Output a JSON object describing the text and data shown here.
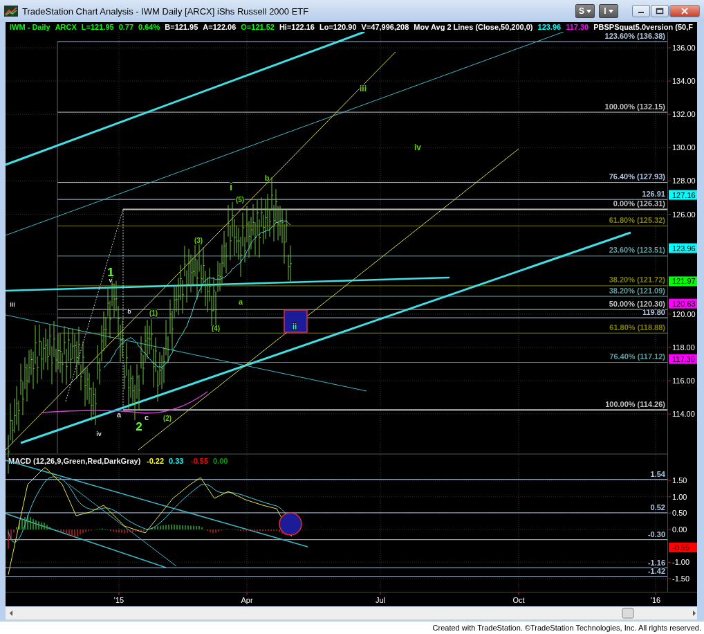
{
  "window": {
    "title": "TradeStation Chart Analysis - IWM Daily [ARCX] iShs Russell 2000 ETF",
    "menu_buttons": [
      "S",
      "I"
    ]
  },
  "header": [
    {
      "text": "IWM - Daily",
      "color": "#00ff00"
    },
    {
      "text": "ARCX",
      "color": "#00ff00"
    },
    {
      "text": "L=121.95",
      "color": "#00ff00"
    },
    {
      "text": "0.77",
      "color": "#00ff00"
    },
    {
      "text": "0.64%",
      "color": "#00ff00"
    },
    {
      "text": "B=121.95",
      "color": "#ffffff"
    },
    {
      "text": "A=122.06",
      "color": "#ffffff"
    },
    {
      "text": "O=121.52",
      "color": "#00ff00"
    },
    {
      "text": "Hi=122.16",
      "color": "#ffffff"
    },
    {
      "text": "Lo=120.90",
      "color": "#ffffff"
    },
    {
      "text": "V=47,996,208",
      "color": "#ffffff"
    },
    {
      "text": "Mov Avg 2 Lines (Close,50,200,0)",
      "color": "#ffffff"
    },
    {
      "text": "123.96",
      "color": "#00ffff"
    },
    {
      "text": "117.30",
      "color": "#ff00ff"
    },
    {
      "text": "PBSPSquat5.0version (50,F",
      "color": "#ffffff"
    }
  ],
  "price_axis": {
    "ticks": [
      "136.00",
      "134.00",
      "132.00",
      "130.00",
      "128.00",
      "126.00",
      "120.00",
      "118.00",
      "116.00",
      "114.00"
    ],
    "badges": [
      {
        "text": "127.16",
        "color": "#00ffff"
      },
      {
        "text": "123.96",
        "color": "#00ffff"
      },
      {
        "text": "121.97",
        "color": "#00ff00"
      },
      {
        "text": "120.63",
        "color": "#ff00ff"
      },
      {
        "text": "117.30",
        "color": "#ff00ff"
      }
    ]
  },
  "fib_levels": [
    {
      "text": "123.60% (136.38)",
      "color": "#b0c4de"
    },
    {
      "text": "100.00% (132.15)",
      "color": "#c0c0c0"
    },
    {
      "text": "76.40% (127.93)",
      "color": "#b0c4de"
    },
    {
      "text": "126.91",
      "color": "#b0c4de"
    },
    {
      "text": "0.00% (126.31)",
      "color": "#c0c0c0"
    },
    {
      "text": "61.80% (125.32)",
      "color": "#808000"
    },
    {
      "text": "23.60% (123.51)",
      "color": "#5f9ea0"
    },
    {
      "text": "38.20% (121.72)",
      "color": "#808000"
    },
    {
      "text": "38.20% (121.09)",
      "color": "#5f9ea0"
    },
    {
      "text": "50.00% (120.30)",
      "color": "#c0c0c0"
    },
    {
      "text": "119.80",
      "color": "#b0c4de"
    },
    {
      "text": "61.80% (118.88)",
      "color": "#808000"
    },
    {
      "text": "76.40% (117.12)",
      "color": "#5f9ea0"
    },
    {
      "text": "100.00% (114.26)",
      "color": "#c0c0c0"
    }
  ],
  "wave_labels": [
    {
      "text": "iii",
      "color": "#66cc00"
    },
    {
      "text": "iv",
      "color": "#66cc00"
    },
    {
      "text": "b",
      "color": "#66cc00"
    },
    {
      "text": "i",
      "color": "#66cc00"
    },
    {
      "text": "(5)",
      "color": "#66cc00"
    },
    {
      "text": "(3)",
      "color": "#66cc00"
    },
    {
      "text": "1",
      "color": "#66ff33"
    },
    {
      "text": "v",
      "color": "#dddddd"
    },
    {
      "text": "iii",
      "color": "#dddddd"
    },
    {
      "text": "b",
      "color": "#dddddd"
    },
    {
      "text": "(1)",
      "color": "#66cc00"
    },
    {
      "text": "a",
      "color": "#66cc00"
    },
    {
      "text": "(4)",
      "color": "#66cc00"
    },
    {
      "text": "ii",
      "color": "#00ffff"
    },
    {
      "text": "a",
      "color": "#dddddd"
    },
    {
      "text": "c",
      "color": "#dddddd"
    },
    {
      "text": "2",
      "color": "#66ff33"
    },
    {
      "text": "(2)",
      "color": "#66cc00"
    },
    {
      "text": "iv",
      "color": "#dddddd"
    }
  ],
  "macd": {
    "title": "MACD (12,26,9,Green,Red,DarkGray)",
    "readings": [
      {
        "text": "-0.22",
        "color": "#ffff00"
      },
      {
        "text": "0.33",
        "color": "#00ffff"
      },
      {
        "text": "-0.55",
        "color": "#ff0000"
      },
      {
        "text": "0.00",
        "color": "#00a000"
      }
    ],
    "ticks": [
      "1.50",
      "1.00",
      "0.50",
      "0.00",
      "-1.00",
      "-1.50"
    ],
    "levels": [
      "1.54",
      "0.52",
      "-0.30",
      "-1.16",
      "-1.42"
    ],
    "badge": {
      "text": "-0.55",
      "color": "#ff0000"
    }
  },
  "time_axis": [
    "'15",
    "Apr",
    "Jul",
    "Oct",
    "'16"
  ],
  "footer": "Created with TradeStation. ©TradeStation Technologies, Inc. All rights reserved."
}
